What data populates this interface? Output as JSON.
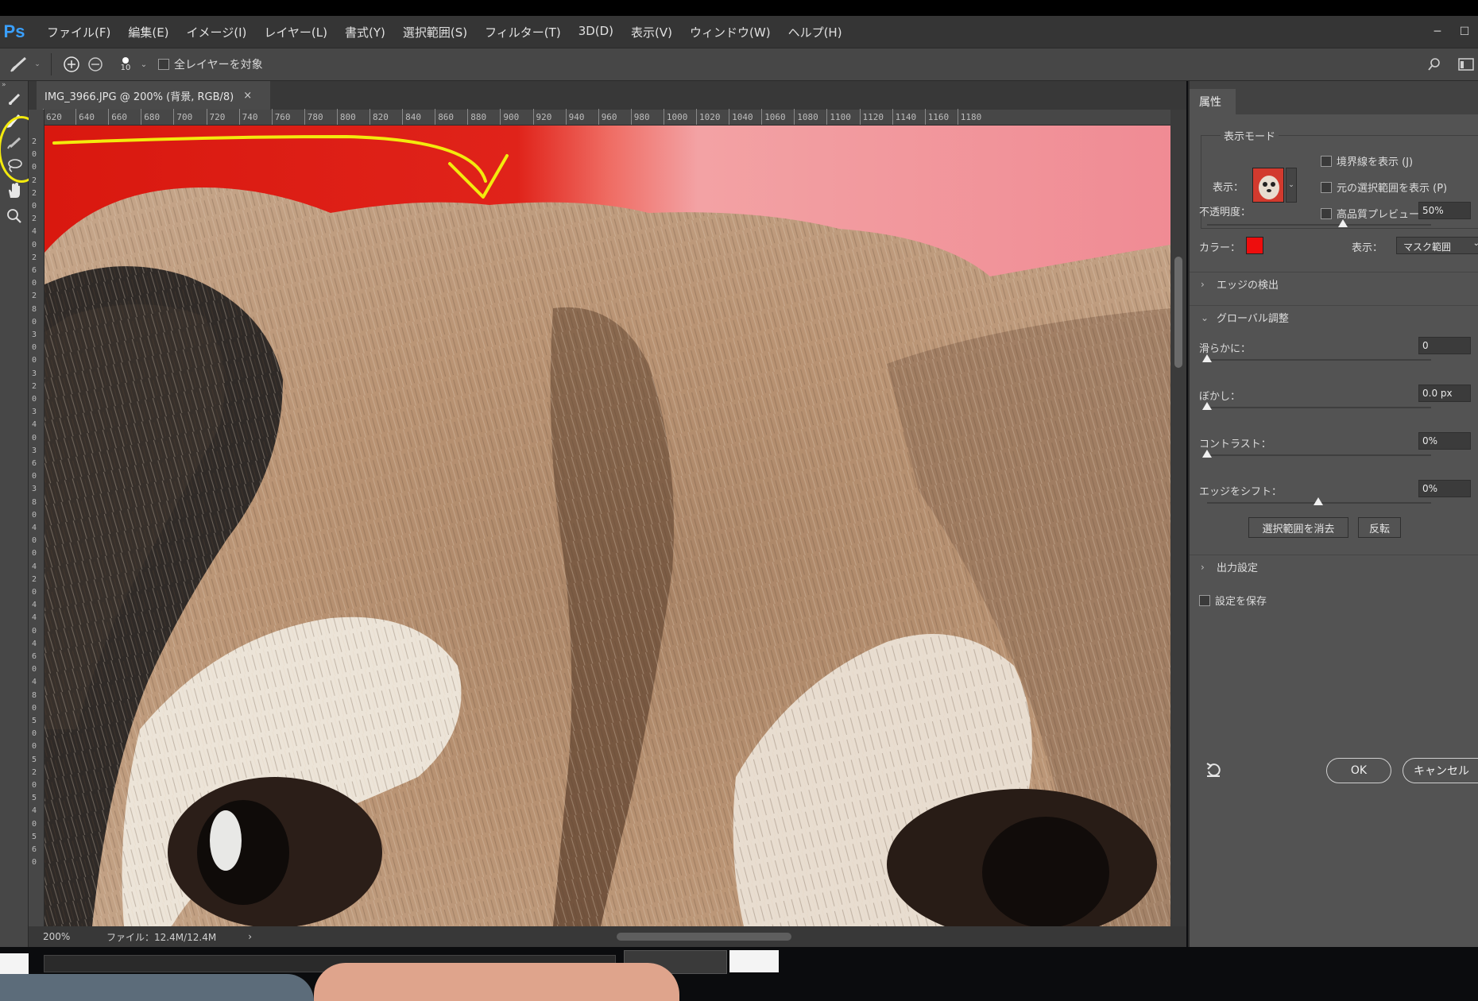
{
  "app": {
    "logo": "Ps"
  },
  "menu": [
    "ファイル(F)",
    "編集(E)",
    "イメージ(I)",
    "レイヤー(L)",
    "書式(Y)",
    "選択範囲(S)",
    "フィルター(T)",
    "3D(D)",
    "表示(V)",
    "ウィンドウ(W)",
    "ヘルプ(H)"
  ],
  "window_controls": {
    "minimize": "─",
    "maximize": "☐"
  },
  "options_bar": {
    "brush_size": "10",
    "sample_all_layers_label": "全レイヤーを対象"
  },
  "document_tab": {
    "title": "IMG_3966.JPG @ 200% (背景, RGB/8)",
    "close": "×"
  },
  "ruler": {
    "h_labels": [
      "620",
      "640",
      "660",
      "680",
      "700",
      "720",
      "740",
      "760",
      "780",
      "800",
      "820",
      "840",
      "860",
      "880",
      "900",
      "920",
      "940",
      "960",
      "980",
      "1000",
      "1020",
      "1040",
      "1060",
      "1080",
      "1100",
      "1120",
      "1140",
      "1160",
      "1180"
    ],
    "v_labels": [
      "2",
      "0",
      "0",
      "2",
      "2",
      "0",
      "2",
      "4",
      "0",
      "2",
      "6",
      "0",
      "2",
      "8",
      "0",
      "3",
      "0",
      "0",
      "3",
      "2",
      "0",
      "3",
      "4",
      "0",
      "3",
      "6",
      "0",
      "3",
      "8",
      "0",
      "4",
      "0",
      "0",
      "4",
      "2",
      "0",
      "4",
      "4",
      "0",
      "4",
      "6",
      "0",
      "4",
      "8",
      "0",
      "5",
      "0",
      "0",
      "5",
      "2",
      "0",
      "5",
      "4",
      "0",
      "5",
      "6",
      "0"
    ]
  },
  "status_bar": {
    "zoom": "200%",
    "file_info": "ファイル：12.4M/12.4M",
    "nav_arrow": "›"
  },
  "properties_panel": {
    "tab": "属性",
    "view_mode_legend": "表示モード",
    "view_label": "表示：",
    "view_dropdown_arrow": "⌄",
    "checkboxes": [
      "境界線を表示 (J)",
      "元の選択範囲を表示 (P)",
      "高品質プレビュー"
    ],
    "opacity_label": "不透明度：",
    "opacity_value": "50%",
    "opacity_level": 0.5,
    "color_label": "カラー：",
    "color_value": "#ee0d0d",
    "display_label": "表示：",
    "display_select": "マスク範囲",
    "edge_detection": "エッジの検出",
    "global_refine": "グローバル調整",
    "smooth_label": "滑らかに：",
    "smooth_value": "0",
    "feather_label": "ぼかし：",
    "feather_value": "0.0 px",
    "contrast_label": "コントラスト：",
    "contrast_value": "0%",
    "shift_edge_label": "エッジをシフト：",
    "shift_edge_value": "0%",
    "clear_selection_button": "選択範囲を消去",
    "invert_button": "反転",
    "output_settings": "出力設定",
    "remember_settings": "設定を保存",
    "ok_button": "OK",
    "cancel_button": "キャンセル"
  },
  "colors": {
    "accent_annotation": "#f3ea0d",
    "ps_blue": "#3aa0ff"
  }
}
